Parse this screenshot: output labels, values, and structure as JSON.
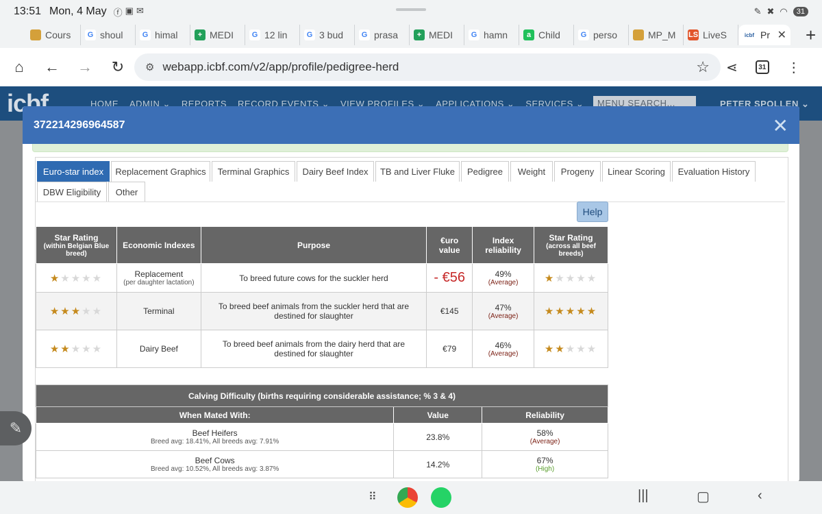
{
  "statusbar": {
    "time": "13:51",
    "date": "Mon, 4 May",
    "battery": "31"
  },
  "browser_tabs": [
    {
      "label": "Cours",
      "fav": "",
      "color": "#d4a03a"
    },
    {
      "label": "shoul",
      "fav": "G",
      "color": "#fff"
    },
    {
      "label": "himal",
      "fav": "G",
      "color": "#fff"
    },
    {
      "label": "MEDI",
      "fav": "+",
      "color": "#22a05a"
    },
    {
      "label": "12 lin",
      "fav": "G",
      "color": "#fff"
    },
    {
      "label": "3 bud",
      "fav": "G",
      "color": "#fff"
    },
    {
      "label": "prasa",
      "fav": "G",
      "color": "#fff"
    },
    {
      "label": "MEDI",
      "fav": "+",
      "color": "#22a05a"
    },
    {
      "label": "hamn",
      "fav": "G",
      "color": "#fff"
    },
    {
      "label": "Child",
      "fav": "a",
      "color": "#20c05b"
    },
    {
      "label": "perso",
      "fav": "G",
      "color": "#fff"
    },
    {
      "label": "MP_M",
      "fav": "",
      "color": "#d4a03a"
    },
    {
      "label": "LiveS",
      "fav": "LS",
      "color": "#e2552b"
    }
  ],
  "active_tab": {
    "label": "Pr",
    "fav": "icbf"
  },
  "url": "webapp.icbf.com/v2/app/profile/pedigree-herd",
  "tab_count": "31",
  "site": {
    "logo": "icbf",
    "menu": [
      "HOME",
      "ADMIN ⌄",
      "REPORTS",
      "RECORD EVENTS ⌄",
      "VIEW PROFILES ⌄",
      "APPLICATIONS ⌄",
      "SERVICES ⌄"
    ],
    "menu_search": "MENU SEARCH...",
    "user": "PETER SPOLLEN ⌄"
  },
  "modal": {
    "title": "372214296964587",
    "tabs_row1": [
      "Euro-star index",
      "Replacement Graphics",
      "Terminal Graphics",
      "Dairy Beef Index",
      "TB and Liver Fluke",
      "Pedigree",
      "Weight",
      "Progeny",
      "Linear Scoring",
      "Evaluation History"
    ],
    "tabs_row2": [
      "DBW Eligibility",
      "Other"
    ],
    "help": "Help"
  },
  "eurostar": {
    "headers": {
      "star_rating": "Star Rating",
      "star_rating_sub": "(within Belgian Blue breed)",
      "economic": "Economic Indexes",
      "purpose": "Purpose",
      "euro_value_l1": "€uro",
      "euro_value_l2": "value",
      "reliability_l1": "Index",
      "reliability_l2": "reliability",
      "star_rating_all": "Star Rating",
      "star_rating_all_sub": "(across all beef breeds)"
    },
    "rows": [
      {
        "stars_within": 1,
        "index": "Replacement",
        "index_sub": "(per daughter lactation)",
        "purpose": "To breed future cows for the suckler herd",
        "value": "- €56",
        "reliability": "49%",
        "rel_label": "(Average)",
        "stars_all": 1
      },
      {
        "stars_within": 3,
        "index": "Terminal",
        "index_sub": "",
        "purpose": "To breed beef animals from the suckler herd that are destined for slaughter",
        "value": "€145",
        "reliability": "47%",
        "rel_label": "(Average)",
        "stars_all": 5
      },
      {
        "stars_within": 2,
        "index": "Dairy Beef",
        "index_sub": "",
        "purpose": "To breed beef animals from the dairy herd that are destined for slaughter",
        "value": "€79",
        "reliability": "46%",
        "rel_label": "(Average)",
        "stars_all": 2
      }
    ]
  },
  "calving": {
    "title": "Calving Difficulty (births requiring considerable assistance; % 3 & 4)",
    "headers": {
      "mated": "When Mated With:",
      "value": "Value",
      "reliability": "Reliability"
    },
    "rows": [
      {
        "name": "Beef Heifers",
        "avg": "Breed avg: 18.41%, All breeds avg: 7.91%",
        "value": "23.8%",
        "reliability": "58%",
        "rel_label": "(Average)"
      },
      {
        "name": "Beef Cows",
        "avg": "Breed avg: 10.52%, All breeds avg: 3.87%",
        "value": "14.2%",
        "reliability": "67%",
        "rel_label": "(High)"
      }
    ]
  }
}
